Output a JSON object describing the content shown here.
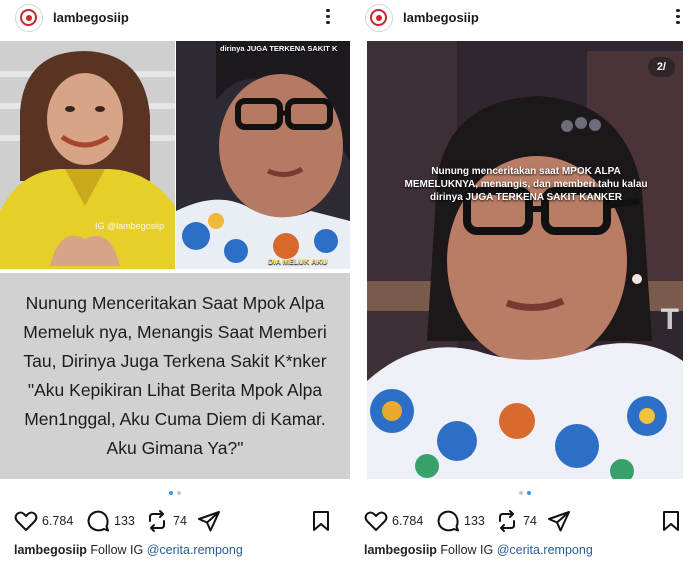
{
  "posts": [
    {
      "username": "lambegosiip",
      "slide_text": "Nunung Menceritakan Saat Mpok Alpa Memeluk nya, Menangis Saat Memberi Tau, Dirinya Juga Terkena Sakit K*nker \"Aku Kepikiran Lihat Berita Mpok Alpa Men1nggal, Aku Cuma Diem di Kamar. Aku Gimana Ya?\"",
      "watermark": "IG @lambegosiip",
      "photo_overlay_top": "dirinya JUGA TERKENA SAKIT K",
      "photo_overlay_bottom": "DIA MELUK AKU",
      "likes": "6.784",
      "comments": "133",
      "reposts": "74",
      "caption_user": "lambegosiip",
      "caption_text": "Follow IG",
      "caption_mention": "@cerita.rempong",
      "carousel_active_index": 0
    },
    {
      "username": "lambegosiip",
      "slide_counter": "2/",
      "overlay_line1": "Nunung menceritakan saat MPOK ALPA",
      "overlay_line2": "MEMELUKNYA, menangis, dan memberi tahu kalau",
      "overlay_line3": "dirinya JUGA TERKENA SAKIT KANKER",
      "tv_mark": "T",
      "likes": "6.784",
      "comments": "133",
      "reposts": "74",
      "caption_user": "lambegosiip",
      "caption_text": "Follow IG",
      "caption_mention": "@cerita.rempong",
      "carousel_active_index": 1
    }
  ],
  "colors": {
    "accent_dot": "#3897f0",
    "mention": "#2b5c97",
    "caption_bg": "#d1d1d1",
    "shirt_yellow": "#e7cf2a"
  },
  "icons": [
    "heart-icon",
    "comment-icon",
    "repost-icon",
    "share-icon",
    "bookmark-icon",
    "more-icon"
  ]
}
